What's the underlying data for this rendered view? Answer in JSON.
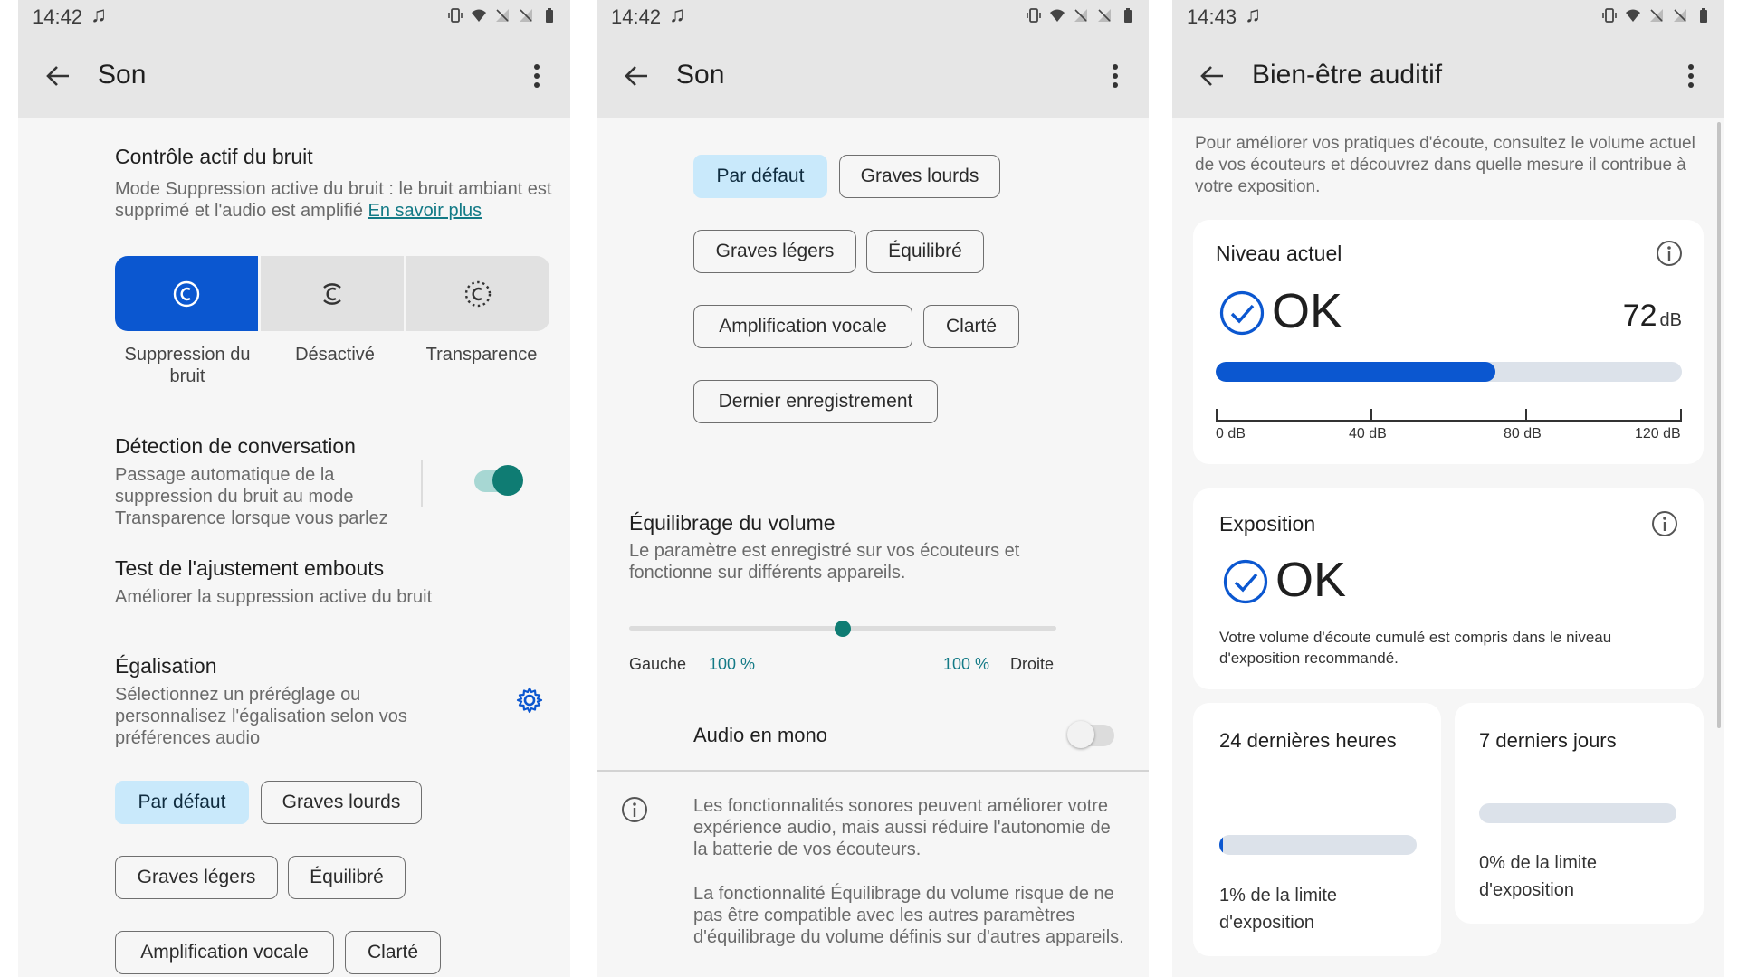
{
  "panel1": {
    "time": "14:42",
    "title": "Son",
    "anc_title": "Contrôle actif du bruit",
    "anc_desc": "Mode Suppression active du bruit : le bruit ambiant est supprimé et l'audio est amplifié",
    "anc_link": "En savoir plus",
    "modes": [
      {
        "label": "Suppression du bruit",
        "selected": true
      },
      {
        "label": "Désactivé",
        "selected": false
      },
      {
        "label": "Transparence",
        "selected": false
      }
    ],
    "conv_title": "Détection de conversation",
    "conv_desc": "Passage automatique de la suppression du bruit au mode Transparence lorsque vous parlez",
    "conv_toggle": "on",
    "fit_title": "Test de l'ajustement embouts",
    "fit_desc": "Améliorer la suppression active du bruit",
    "eq_title": "Égalisation",
    "eq_desc": "Sélectionnez un préréglage ou personnalisez l'égalisation selon vos préférences audio",
    "chips": [
      "Par défaut",
      "Graves lourds",
      "Graves légers",
      "Équilibré",
      "Amplification vocale",
      "Clarté"
    ]
  },
  "panel2": {
    "time": "14:42",
    "title": "Son",
    "chips": [
      "Par défaut",
      "Graves lourds",
      "Graves légers",
      "Équilibré",
      "Amplification vocale",
      "Clarté",
      "Dernier enregistrement"
    ],
    "balance_title": "Équilibrage du volume",
    "balance_desc": "Le paramètre est enregistré sur vos écouteurs et fonctionne sur différents appareils.",
    "balance_position": 0.5,
    "left_label": "Gauche",
    "left_value": "100 %",
    "right_value": "100 %",
    "right_label": "Droite",
    "mono_label": "Audio en mono",
    "mono_toggle": "off",
    "info1": "Les fonctionnalités sonores peuvent améliorer votre expérience audio, mais aussi réduire l'autonomie de la batterie de vos écouteurs.",
    "info2": "La fonctionnalité Équilibrage du volume risque de ne pas être compatible avec les autres paramètres d'équilibrage du volume définis sur d'autres appareils."
  },
  "panel3": {
    "time": "14:43",
    "title": "Bien-être auditif",
    "intro": "Pour améliorer vos pratiques d'écoute, consultez le volume actuel de vos écouteurs et découvrez dans quelle mesure il contribue à votre exposition.",
    "level_title": "Niveau actuel",
    "level_status": "OK",
    "level_value": "72",
    "level_unit": "dB",
    "level_fraction": 0.6,
    "ticks": [
      "0 dB",
      "40 dB",
      "80 dB",
      "120 dB"
    ],
    "expo_title": "Exposition",
    "expo_status": "OK",
    "expo_desc": "Votre volume d'écoute cumulé est compris dans le niveau d'exposition recommandé.",
    "day_title": "24 dernières heures",
    "day_value": "1% de la limite d'exposition",
    "day_fraction": 0.01,
    "week_title": "7 derniers jours",
    "week_value": "0% de la limite d'exposition",
    "week_fraction": 0
  },
  "colors": {
    "accent": "#0b57d0",
    "teal": "#0f7c73",
    "chip_selected": "#c9e9fb",
    "link": "#137a86"
  }
}
